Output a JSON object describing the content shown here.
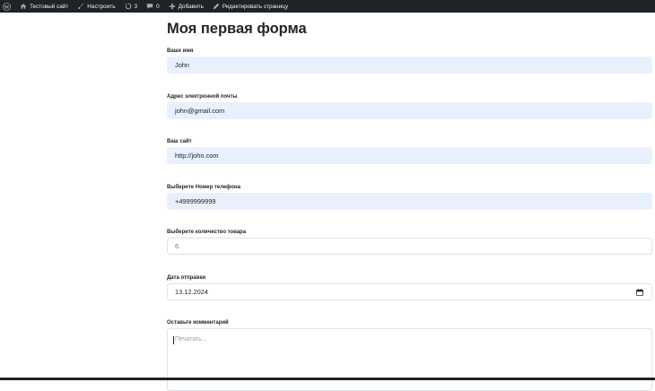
{
  "adminbar": {
    "site_name": "Тестовый сайт",
    "customize": "Настроить",
    "updates_count": "3",
    "comments_count": "0",
    "add_new": "Добавить",
    "edit_page": "Редактировать страницу"
  },
  "form": {
    "title": "Моя первая форма",
    "fields": [
      {
        "label": "Ваше имя",
        "value": "John"
      },
      {
        "label": "Адрес электронной почты",
        "value": "john@gmail.com"
      },
      {
        "label": "Ваш сайт",
        "value": "http://john.com"
      },
      {
        "label": "Выберите Номер телефона",
        "value": "+4999999999"
      },
      {
        "label": "Выберите количество товара",
        "value": "6"
      },
      {
        "label": "Дата отправки",
        "value": "13.12.2024"
      },
      {
        "label": "Оставьте комментарий",
        "placeholder": "Печатать..."
      }
    ]
  },
  "colors": {
    "adminbar_bg": "#1d2327",
    "autofill_bg": "#e8f0fe",
    "border": "#dee2e6"
  }
}
